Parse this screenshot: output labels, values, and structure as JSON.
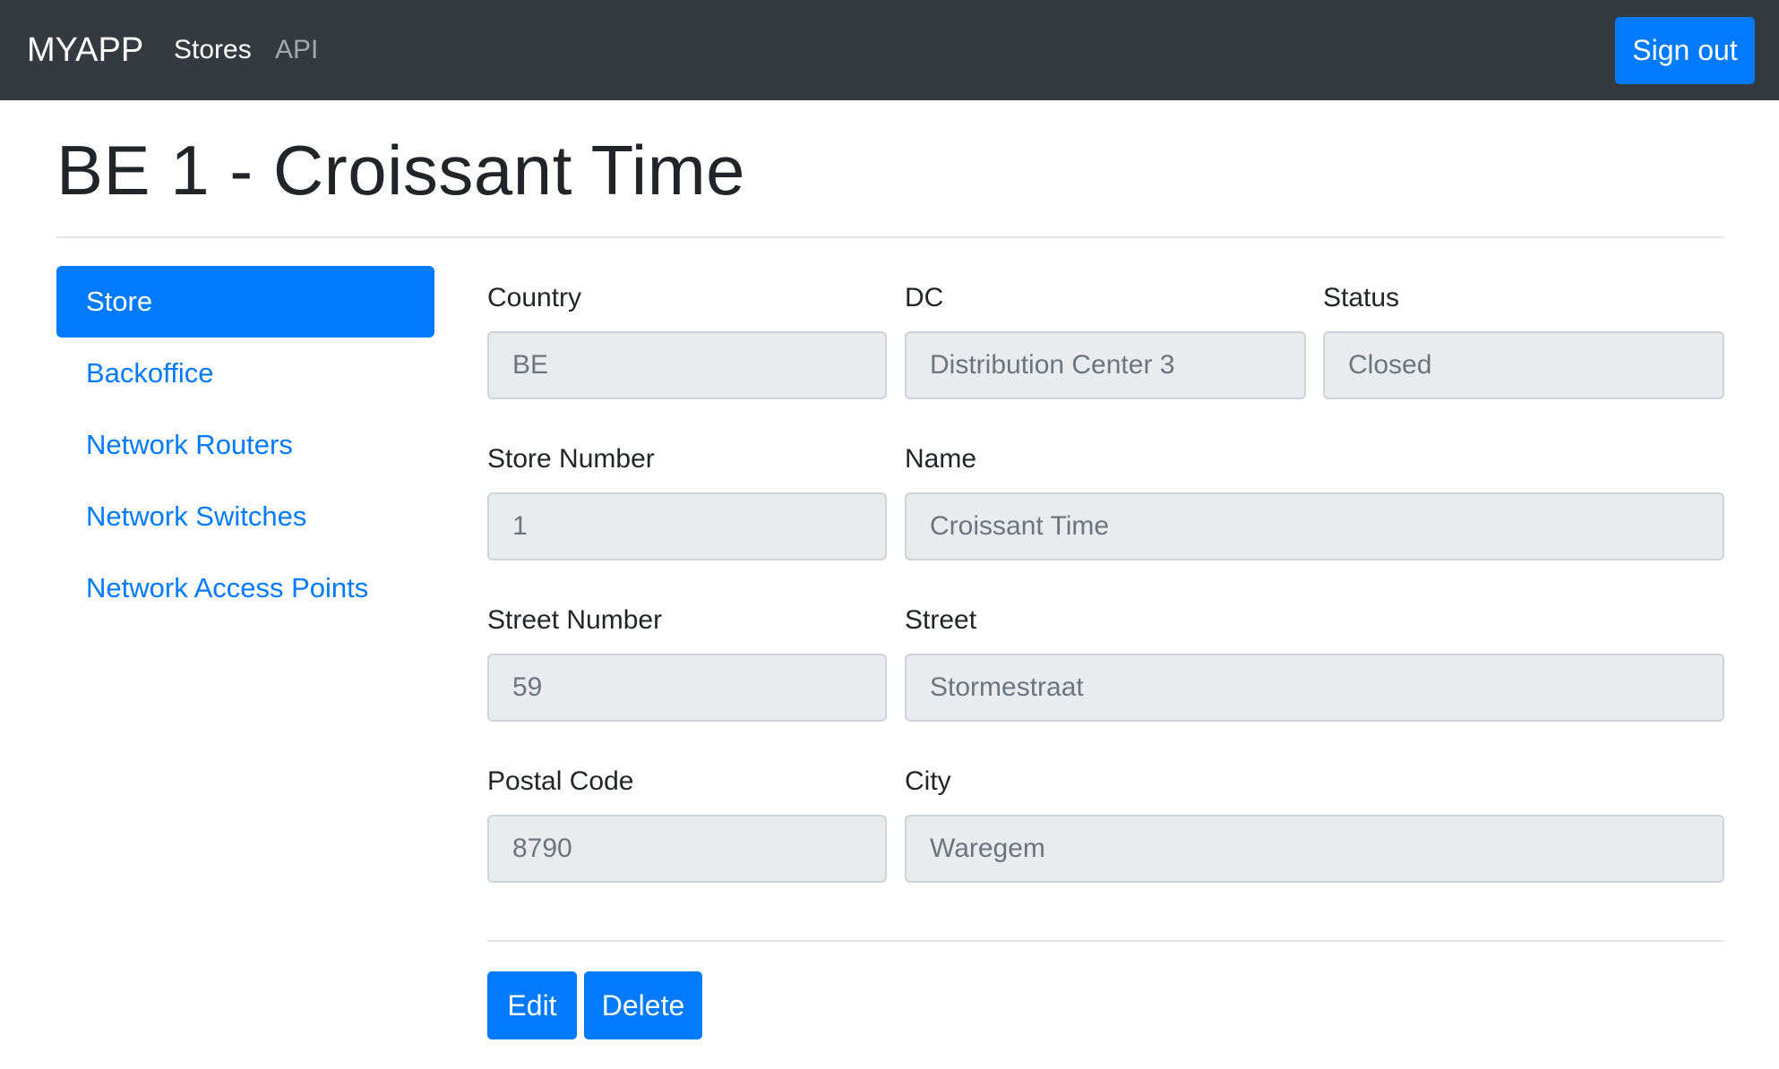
{
  "navbar": {
    "brand": "MYAPP",
    "links": [
      "Stores",
      "API"
    ],
    "signout_label": "Sign out"
  },
  "page": {
    "title": "BE 1 - Croissant Time"
  },
  "sidebar": {
    "items": [
      {
        "label": "Store",
        "active": true
      },
      {
        "label": "Backoffice",
        "active": false
      },
      {
        "label": "Network Routers",
        "active": false
      },
      {
        "label": "Network Switches",
        "active": false
      },
      {
        "label": "Network Access Points",
        "active": false
      }
    ]
  },
  "form": {
    "country": {
      "label": "Country",
      "value": "BE"
    },
    "dc": {
      "label": "DC",
      "value": "Distribution Center 3"
    },
    "status": {
      "label": "Status",
      "value": "Closed"
    },
    "store_number": {
      "label": "Store Number",
      "value": "1"
    },
    "name": {
      "label": "Name",
      "value": "Croissant Time"
    },
    "street_number": {
      "label": "Street Number",
      "value": "59"
    },
    "street": {
      "label": "Street",
      "value": "Stormestraat"
    },
    "postal_code": {
      "label": "Postal Code",
      "value": "8790"
    },
    "city": {
      "label": "City",
      "value": "Waregem"
    }
  },
  "actions": {
    "edit_label": "Edit",
    "delete_label": "Delete"
  },
  "colors": {
    "navbar_bg": "#343a40",
    "primary": "#007bff",
    "field_bg": "#e9ecef"
  }
}
